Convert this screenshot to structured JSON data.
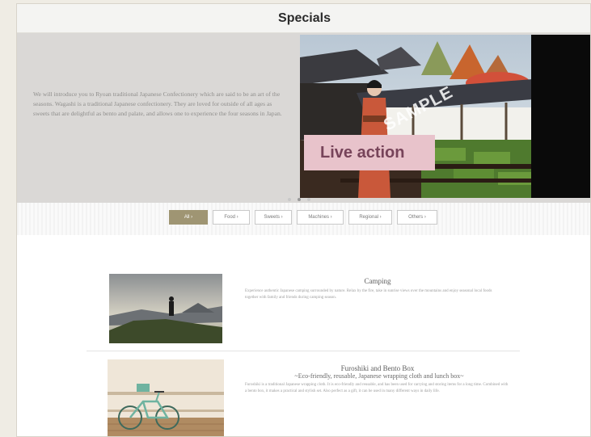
{
  "header": {
    "title": "Specials"
  },
  "hero": {
    "text": "We will introduce you to Ryoan traditional Japanese Confectionery which are said to be an art of the seasons. Wagashi is a traditional Japanese confectionery. They are loved for outside of all ages as sweets that are delightful as bento and palate, and allows one to experience the four seasons in Japan.",
    "watermark": "SAMPLE",
    "badge": "Live action",
    "badge_bg": "#e8c3cb",
    "badge_color": "#77445a"
  },
  "carousel": {
    "dots": 3,
    "active": 1
  },
  "filters": [
    {
      "label": "All",
      "active": true
    },
    {
      "label": "Food",
      "active": false
    },
    {
      "label": "Sweets",
      "active": false
    },
    {
      "label": "Machines",
      "active": false
    },
    {
      "label": "Regional",
      "active": false
    },
    {
      "label": "Others",
      "active": false
    }
  ],
  "cards": [
    {
      "title": "Camping",
      "subtitle": "",
      "body": "Experience authentic Japanese camping surrounded by nature. Relax by the fire, take in sunrise views over the mountains and enjoy seasonal local foods together with family and friends during camping season."
    },
    {
      "title": "Furoshiki and Bento Box",
      "subtitle": "~Eco-friendly, reusable, Japanese wrapping cloth and lunch box~",
      "body": "Furoshiki is a traditional Japanese wrapping cloth. It is eco-friendly and reusable, and has been used for carrying and storing items for a long time. Combined with a bento box, it makes a practical and stylish set. Also perfect as a gift, it can be used in many different ways in daily life."
    }
  ],
  "colors": {
    "accent": "#9f9573",
    "hero_bg": "#dad8d6",
    "page_bg": "#efece4"
  }
}
